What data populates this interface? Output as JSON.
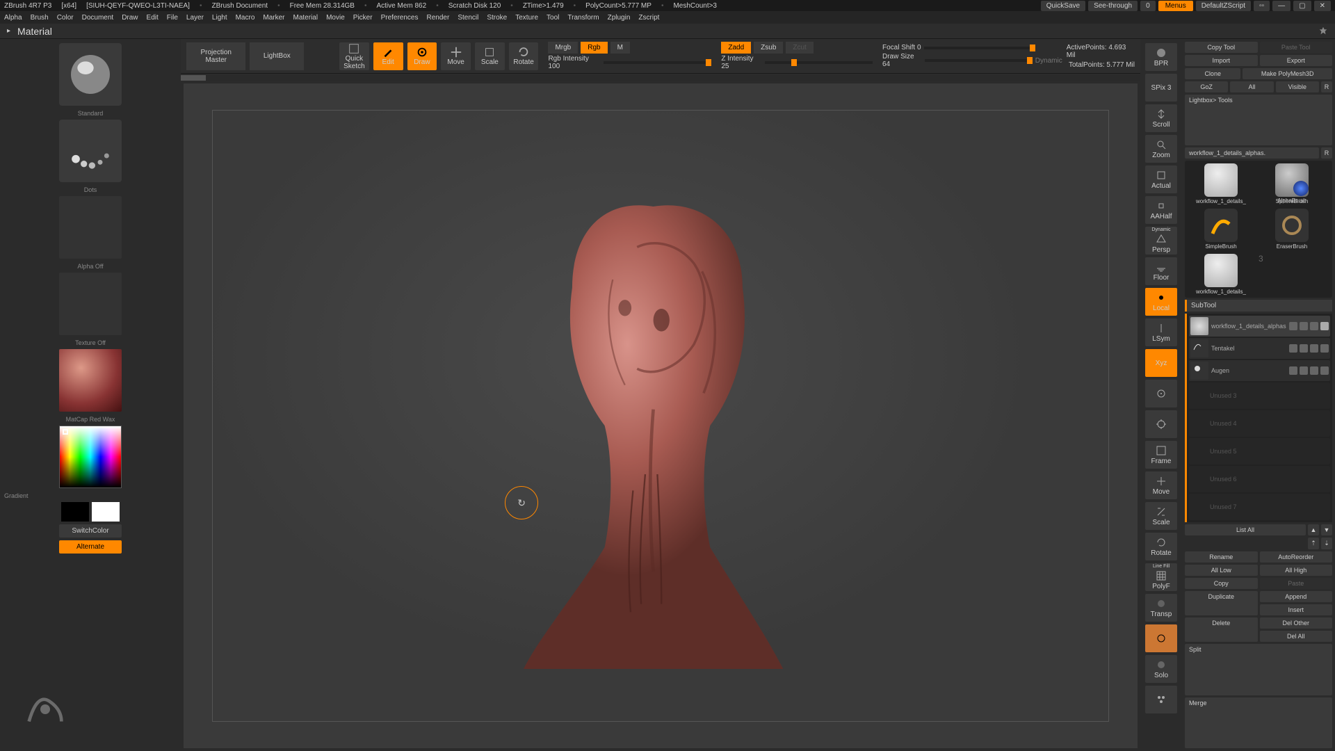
{
  "title": {
    "app": "ZBrush 4R7 P3",
    "arch": "[x64]",
    "session": "[SIUH-QEYF-QWEO-L3TI-NAEA]",
    "doc": "ZBrush Document",
    "freemem": "Free Mem 28.314GB",
    "activemem": "Active Mem 862",
    "scratch": "Scratch Disk 120",
    "ztime": "ZTime>1.479",
    "poly": "PolyCount>5.777 MP",
    "mesh": "MeshCount>3"
  },
  "topright": {
    "quicksave": "QuickSave",
    "seethrough": "See-through",
    "seethrough_val": "0",
    "menus": "Menus",
    "script": "DefaultZScript"
  },
  "menu": [
    "Alpha",
    "Brush",
    "Color",
    "Document",
    "Draw",
    "Edit",
    "File",
    "Layer",
    "Light",
    "Macro",
    "Marker",
    "Material",
    "Movie",
    "Picker",
    "Preferences",
    "Render",
    "Stencil",
    "Stroke",
    "Texture",
    "Tool",
    "Transform",
    "Zplugin",
    "Zscript"
  ],
  "info_label": "Material",
  "toolbar": {
    "projection": "Projection",
    "master": "Master",
    "lightbox": "LightBox",
    "quick": "Quick",
    "sketch": "Sketch",
    "edit": "Edit",
    "draw": "Draw",
    "move": "Move",
    "scale": "Scale",
    "rotate": "Rotate",
    "mrgb": "Mrgb",
    "rgb": "Rgb",
    "m": "M",
    "rgb_int": "Rgb Intensity 100",
    "zadd": "Zadd",
    "zsub": "Zsub",
    "zcut": "Zcut",
    "z_int": "Z Intensity 25",
    "focal": "Focal Shift 0",
    "drawsize": "Draw Size 64",
    "dynamic": "Dynamic",
    "activepts": "ActivePoints:",
    "activepts_v": "4.693 Mil",
    "totalpts": "TotalPoints:",
    "totalpts_v": "5.777 Mil"
  },
  "left": {
    "brush": "Standard",
    "dots": "Dots",
    "alpha": "Alpha Off",
    "texture": "Texture Off",
    "material": "MatCap Red Wax",
    "gradient": "Gradient",
    "switch": "SwitchColor",
    "alternate": "Alternate"
  },
  "nav": {
    "bpr": "BPR",
    "spix": "SPix 3",
    "scroll": "Scroll",
    "zoom": "Zoom",
    "actual": "Actual",
    "aatialf": "AAHalf",
    "persp": "Persp",
    "dynamic": "Dynamic",
    "floor": "Floor",
    "local": "Local",
    "lsym": "LSym",
    "xyz": "Xyz",
    "frame": "Frame",
    "move": "Move",
    "scale": "Scale",
    "rotate": "Rotate",
    "linefill": "Line Fill",
    "transp": "Transp",
    "solo": "Solo",
    "ghost": "Ghost",
    "polyframe": "PolyF"
  },
  "right": {
    "copytool": "Copy Tool",
    "pastetool": "Paste Tool",
    "import": "Import",
    "export": "Export",
    "clone": "Clone",
    "makepoly": "Make PolyMesh3D",
    "goz": "GoZ",
    "all": "All",
    "visible": "Visible",
    "r": "R",
    "lightboxtools": "Lightbox> Tools",
    "toolname": "workflow_1_details_alphas.",
    "tools": {
      "t1": "workflow_1_details_",
      "t2": "SphereBrush",
      "t3": "AlphaBrush",
      "t4": "SimpleBrush",
      "t5": "EraserBrush",
      "t6": "workflow_1_details_"
    },
    "subtool": "SubTool",
    "sub_items": [
      {
        "name": "workflow_1_details_alphas",
        "sel": true
      },
      {
        "name": "Tentakel",
        "sel": false
      },
      {
        "name": "Augen",
        "sel": false
      }
    ],
    "empty": [
      "Unused 3",
      "Unused 4",
      "Unused 5",
      "Unused 6",
      "Unused 7"
    ],
    "listall": "List All",
    "rename": "Rename",
    "autoreorder": "AutoReorder",
    "alllow": "All Low",
    "allhigh": "All High",
    "copy": "Copy",
    "paste": "Paste",
    "duplicate": "Duplicate",
    "append": "Append",
    "insert": "Insert",
    "delete": "Delete",
    "delother": "Del Other",
    "delall": "Del All",
    "split": "Split",
    "merge": "Merge"
  }
}
